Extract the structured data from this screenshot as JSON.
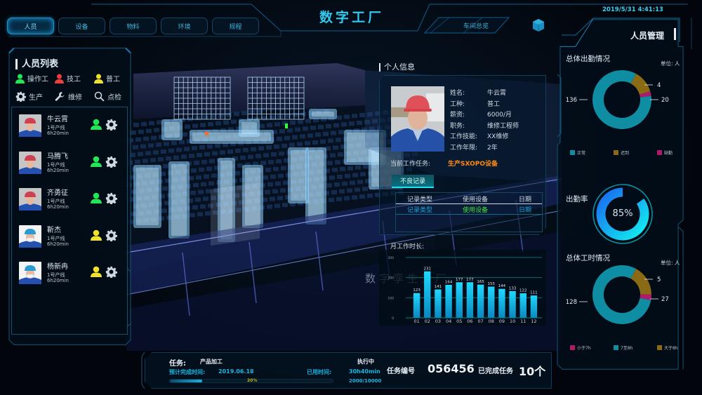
{
  "header": {
    "title": "数字工厂",
    "datetime": "2019/5/31 4:41:13",
    "overview_label": "车间总览",
    "tabs": [
      {
        "label": "人员",
        "active": true
      },
      {
        "label": "设备",
        "active": false
      },
      {
        "label": "物料",
        "active": false
      },
      {
        "label": "环境",
        "active": false
      },
      {
        "label": "规程",
        "active": false
      }
    ]
  },
  "scene": {
    "watermark": "数字孪生工厂"
  },
  "left_panel": {
    "title": "人员列表",
    "legend_roles": [
      {
        "label": "操作工",
        "color": "#22e655",
        "icon": "person-icon"
      },
      {
        "label": "技工",
        "color": "#f03c3c",
        "icon": "person-icon"
      },
      {
        "label": "普工",
        "color": "#f0e22c",
        "icon": "person-icon"
      }
    ],
    "legend_status": [
      {
        "label": "生产",
        "icon": "gear-icon"
      },
      {
        "label": "维修",
        "icon": "wrench-icon"
      },
      {
        "label": "点检",
        "icon": "search-icon"
      }
    ],
    "people": [
      {
        "name": "牛云霄",
        "line": "1号产线",
        "time": "6h20min",
        "role_color": "#22e655",
        "helmet": "#d04050"
      },
      {
        "name": "马腾飞",
        "line": "1号产线",
        "time": "6h20min",
        "role_color": "#22e655",
        "helmet": "#d04050"
      },
      {
        "name": "齐勇征",
        "line": "1号产线",
        "time": "6h20min",
        "role_color": "#22e655",
        "helmet": "#d04050"
      },
      {
        "name": "靳杰",
        "line": "1号产线",
        "time": "6h20min",
        "role_color": "#f0e22c",
        "helmet": "#2a9ad0"
      },
      {
        "name": "杨新冉",
        "line": "1号产线",
        "time": "6h20min",
        "role_color": "#f0e22c",
        "helmet": "#2a9ad0"
      }
    ]
  },
  "info": {
    "title": "个人信息",
    "fields": [
      {
        "key": "姓名:",
        "value": "牛云霄"
      },
      {
        "key": "工种:",
        "value": "普工"
      },
      {
        "key": "薪资:",
        "value": "6000/月"
      },
      {
        "key": "职务:",
        "value": "维修工程师"
      },
      {
        "key": "工作技能:",
        "value": "XX维修"
      },
      {
        "key": "工作年限:",
        "value": "2年"
      }
    ],
    "task_label": "当前工作任务:",
    "task_value": "生产SXOPO设备",
    "tab_label": "不良记录",
    "record_headers": [
      "记录类型",
      "使用设备",
      "日期"
    ],
    "record_row": [
      "记录类型",
      "使用设备",
      "日期"
    ],
    "chart_title": "月工作时长:"
  },
  "chart_data": [
    {
      "type": "bar",
      "title": "月工作时长",
      "categories": [
        "01",
        "02",
        "03",
        "04",
        "05",
        "06",
        "07",
        "08",
        "09",
        "10",
        "11",
        "12"
      ],
      "values": [
        123,
        231,
        141,
        164,
        177,
        177,
        165,
        155,
        144,
        133,
        122,
        111
      ],
      "yticks": [
        0,
        100,
        200,
        300
      ],
      "ylim": [
        0,
        300
      ],
      "grid": true,
      "color": "#12c8f4"
    },
    {
      "type": "pie",
      "title": "总体出勤情况",
      "unit": "单位: 人",
      "donut": true,
      "slices": [
        {
          "label": "正常",
          "value": 136,
          "color": "#0e8da3"
        },
        {
          "label": "迟到",
          "value": 20,
          "color": "#8a6a14"
        },
        {
          "label": "缺勤",
          "value": 4,
          "color": "#b01a6a"
        }
      ]
    },
    {
      "type": "pie",
      "title": "出勤率",
      "donut": true,
      "value_percent": 85,
      "label": "85%"
    },
    {
      "type": "pie",
      "title": "总体工时情况",
      "unit": "单位: 人",
      "donut": true,
      "slices": [
        {
          "label": "7至8h",
          "value": 128,
          "color": "#0e8da3"
        },
        {
          "label": "大于8h",
          "value": 27,
          "color": "#8a6a14"
        },
        {
          "label": "小于7h",
          "value": 5,
          "color": "#b01a6a"
        }
      ],
      "legend_order": [
        "小于7h",
        "7至8h",
        "大于8h"
      ]
    }
  ],
  "right_panel": {
    "title": "人员管理",
    "attendance_title": "总体出勤情况",
    "rate_title": "出勤率",
    "hours_title": "总体工时情况",
    "unit": "单位: 人"
  },
  "bottom": {
    "task_label": "任务:",
    "task_value": "产品加工",
    "status": "执行中",
    "eta_label": "预计完成时间:",
    "eta_value": "2019.06.18",
    "used_label": "已用时间:",
    "used_value": "30h40min",
    "progress_percent": 20,
    "progress_label": "20%",
    "progress_count": "2000/10000",
    "task_no_label": "任务编号",
    "task_no": "056456",
    "done_label": "已完成任务",
    "done_value": "10个"
  }
}
